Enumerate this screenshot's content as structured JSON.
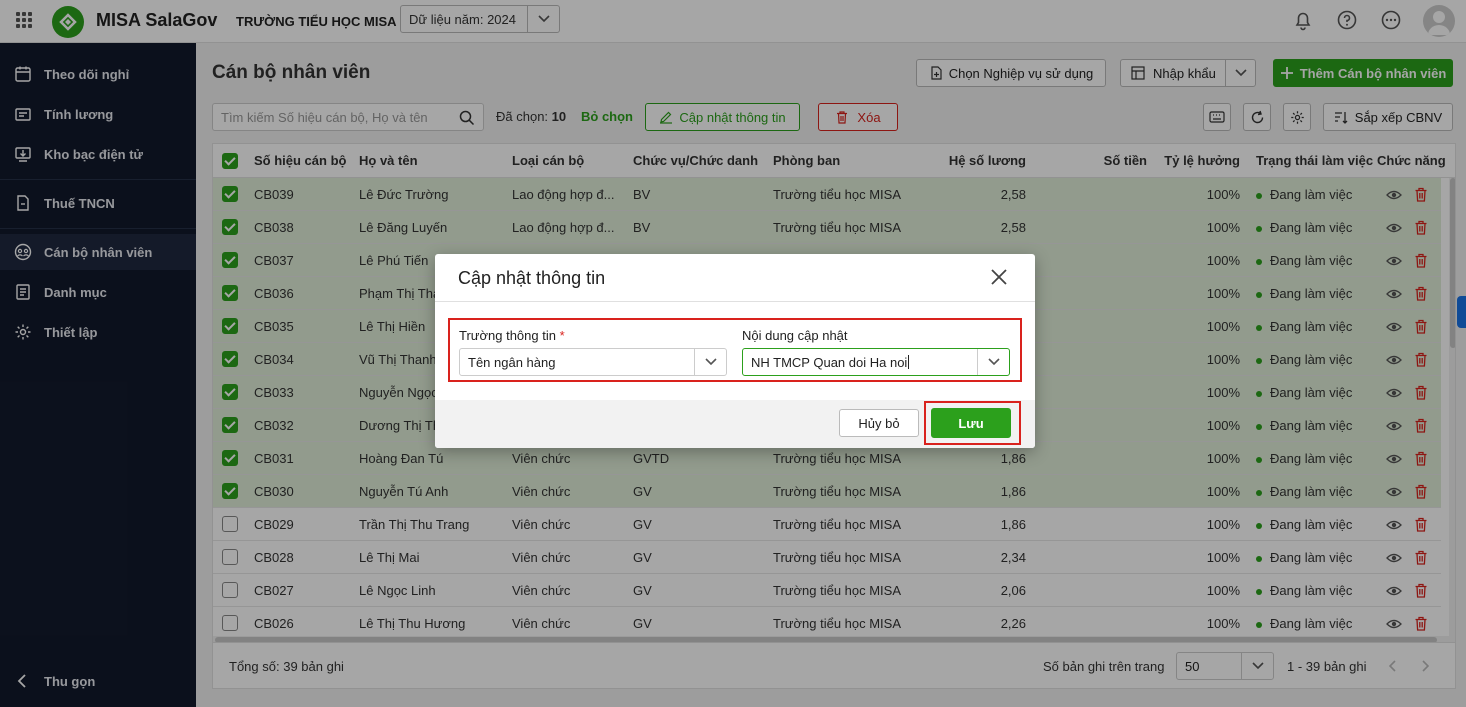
{
  "app": {
    "name": "MISA SalaGov",
    "school": "TRƯỜNG TIỂU HỌC MISA",
    "year_label": "Dữ liệu năm: 2024"
  },
  "sidebar": {
    "items": [
      {
        "label": "Theo dõi nghỉ",
        "icon": "calendar-icon"
      },
      {
        "label": "Tính lương",
        "icon": "salary-icon"
      },
      {
        "label": "Kho bạc điện tử",
        "icon": "treasury-icon"
      },
      {
        "label": "Thuế TNCN",
        "icon": "tax-document-icon"
      },
      {
        "label": "Cán bộ nhân viên",
        "icon": "staff-icon"
      },
      {
        "label": "Danh mục",
        "icon": "catalog-icon"
      },
      {
        "label": "Thiết lập",
        "icon": "gear-icon"
      }
    ],
    "collapse_label": "Thu gọn"
  },
  "page": {
    "title": "Cán bộ nhân viên"
  },
  "toolbar": {
    "choose_business": "Chọn Nghiệp vụ sử dụng",
    "import": "Nhập khẩu",
    "add_staff": "Thêm Cán bộ nhân viên",
    "search_placeholder": "Tìm kiếm Số hiệu cán bộ, Họ và tên",
    "selected_label": "Đã chọn:",
    "selected_count": "10",
    "deselect": "Bỏ chọn",
    "update_info": "Cập nhật thông tin",
    "delete": "Xóa",
    "sort": "Sắp xếp CBNV"
  },
  "table": {
    "columns": [
      "Số hiệu cán bộ",
      "Họ và tên",
      "Loại cán bộ",
      "Chức vụ/Chức danh",
      "Phòng ban",
      "Hệ số lương",
      "Số tiền",
      "Tỷ lệ hưởng",
      "Trạng thái làm việc",
      "Chức năng"
    ],
    "rows": [
      {
        "code": "CB039",
        "name": "Lê Đức Trường",
        "type": "Lao động hợp đ...",
        "position": "BV",
        "dept": "Trường tiểu học MISA",
        "coef": "2,58",
        "amount": "",
        "rate": "100%",
        "status": "Đang làm việc",
        "selected": true
      },
      {
        "code": "CB038",
        "name": "Lê Đăng Luyến",
        "type": "Lao động hợp đ...",
        "position": "BV",
        "dept": "Trường tiểu học MISA",
        "coef": "2,58",
        "amount": "",
        "rate": "100%",
        "status": "Đang làm việc",
        "selected": true
      },
      {
        "code": "CB037",
        "name": "Lê Phú Tiến",
        "type": "",
        "position": "",
        "dept": "",
        "coef": "",
        "amount": "",
        "rate": "100%",
        "status": "Đang làm việc",
        "selected": true
      },
      {
        "code": "CB036",
        "name": "Phạm Thị Tha",
        "type": "",
        "position": "",
        "dept": "",
        "coef": "",
        "amount": "",
        "rate": "100%",
        "status": "Đang làm việc",
        "selected": true
      },
      {
        "code": "CB035",
        "name": "Lê Thị Hiền",
        "type": "",
        "position": "",
        "dept": "",
        "coef": "",
        "amount": "",
        "rate": "100%",
        "status": "Đang làm việc",
        "selected": true
      },
      {
        "code": "CB034",
        "name": "Vũ Thị Thanh",
        "type": "",
        "position": "",
        "dept": "",
        "coef": "",
        "amount": "",
        "rate": "100%",
        "status": "Đang làm việc",
        "selected": true
      },
      {
        "code": "CB033",
        "name": "Nguyễn Ngọc",
        "type": "",
        "position": "",
        "dept": "",
        "coef": "",
        "amount": "",
        "rate": "100%",
        "status": "Đang làm việc",
        "selected": true
      },
      {
        "code": "CB032",
        "name": "Dương Thị Th",
        "type": "",
        "position": "",
        "dept": "",
        "coef": "",
        "amount": "",
        "rate": "100%",
        "status": "Đang làm việc",
        "selected": true
      },
      {
        "code": "CB031",
        "name": "Hoàng Đan Tú",
        "type": "Viên chức",
        "position": "GVTD",
        "dept": "Trường tiểu học MISA",
        "coef": "1,86",
        "amount": "",
        "rate": "100%",
        "status": "Đang làm việc",
        "selected": true
      },
      {
        "code": "CB030",
        "name": "Nguyễn Tú Anh",
        "type": "Viên chức",
        "position": "GV",
        "dept": "Trường tiểu học MISA",
        "coef": "1,86",
        "amount": "",
        "rate": "100%",
        "status": "Đang làm việc",
        "selected": true
      },
      {
        "code": "CB029",
        "name": "Trần Thị Thu Trang",
        "type": "Viên chức",
        "position": "GV",
        "dept": "Trường tiểu học MISA",
        "coef": "1,86",
        "amount": "",
        "rate": "100%",
        "status": "Đang làm việc",
        "selected": false
      },
      {
        "code": "CB028",
        "name": "Lê Thị Mai",
        "type": "Viên chức",
        "position": "GV",
        "dept": "Trường tiểu học MISA",
        "coef": "2,34",
        "amount": "",
        "rate": "100%",
        "status": "Đang làm việc",
        "selected": false
      },
      {
        "code": "CB027",
        "name": "Lê Ngọc Linh",
        "type": "Viên chức",
        "position": "GV",
        "dept": "Trường tiểu học MISA",
        "coef": "2,06",
        "amount": "",
        "rate": "100%",
        "status": "Đang làm việc",
        "selected": false
      },
      {
        "code": "CB026",
        "name": "Lê Thị Thu Hương",
        "type": "Viên chức",
        "position": "GV",
        "dept": "Trường tiểu học MISA",
        "coef": "2,26",
        "amount": "",
        "rate": "100%",
        "status": "Đang làm việc",
        "selected": false
      }
    ]
  },
  "footer": {
    "total_label": "Tổng số:",
    "total_value": "39 bản ghi",
    "per_page_label": "Số bản ghi trên trang",
    "per_page_value": "50",
    "range": "1 - 39 bản ghi"
  },
  "modal": {
    "title": "Cập nhật thông tin",
    "field_label": "Trường thông tin",
    "field_required_mark": "*",
    "field_value": "Tên ngân hàng",
    "content_label": "Nội dung cập nhật",
    "content_value": "NH TMCP Quan doi Ha noi",
    "cancel": "Hủy bỏ",
    "save": "Lưu"
  },
  "colors": {
    "brand_green": "#2ca01c",
    "sidebar_bg": "#121a2c",
    "delete_red": "#d9221d",
    "selected_row": "#e0efd9"
  }
}
